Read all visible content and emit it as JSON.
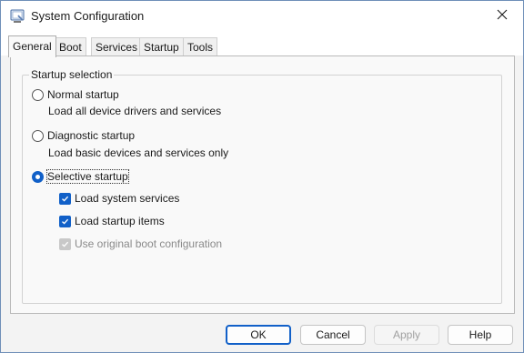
{
  "window": {
    "title": "System Configuration",
    "icon": "msconfig-icon",
    "close_icon": "close-icon"
  },
  "tabs": [
    {
      "label": "General",
      "active": true
    },
    {
      "label": "Boot",
      "active": false
    },
    {
      "label": "Services",
      "active": false
    },
    {
      "label": "Startup",
      "active": false
    },
    {
      "label": "Tools",
      "active": false
    }
  ],
  "general": {
    "group_label": "Startup selection",
    "normal": {
      "label": "Normal startup",
      "description": "Load all device drivers and services",
      "selected": false
    },
    "diagnostic": {
      "label": "Diagnostic startup",
      "description": "Load basic devices and services only",
      "selected": false
    },
    "selective": {
      "label": "Selective startup",
      "selected": true
    },
    "options": [
      {
        "label": "Load system services",
        "checked": true,
        "enabled": true
      },
      {
        "label": "Load startup items",
        "checked": true,
        "enabled": true
      },
      {
        "label": "Use original boot configuration",
        "checked": true,
        "enabled": false
      }
    ]
  },
  "buttons": {
    "ok": "OK",
    "cancel": "Cancel",
    "apply": "Apply",
    "help": "Help"
  },
  "colors": {
    "accent": "#1160c8",
    "disabled_text": "#8a8a8a"
  }
}
